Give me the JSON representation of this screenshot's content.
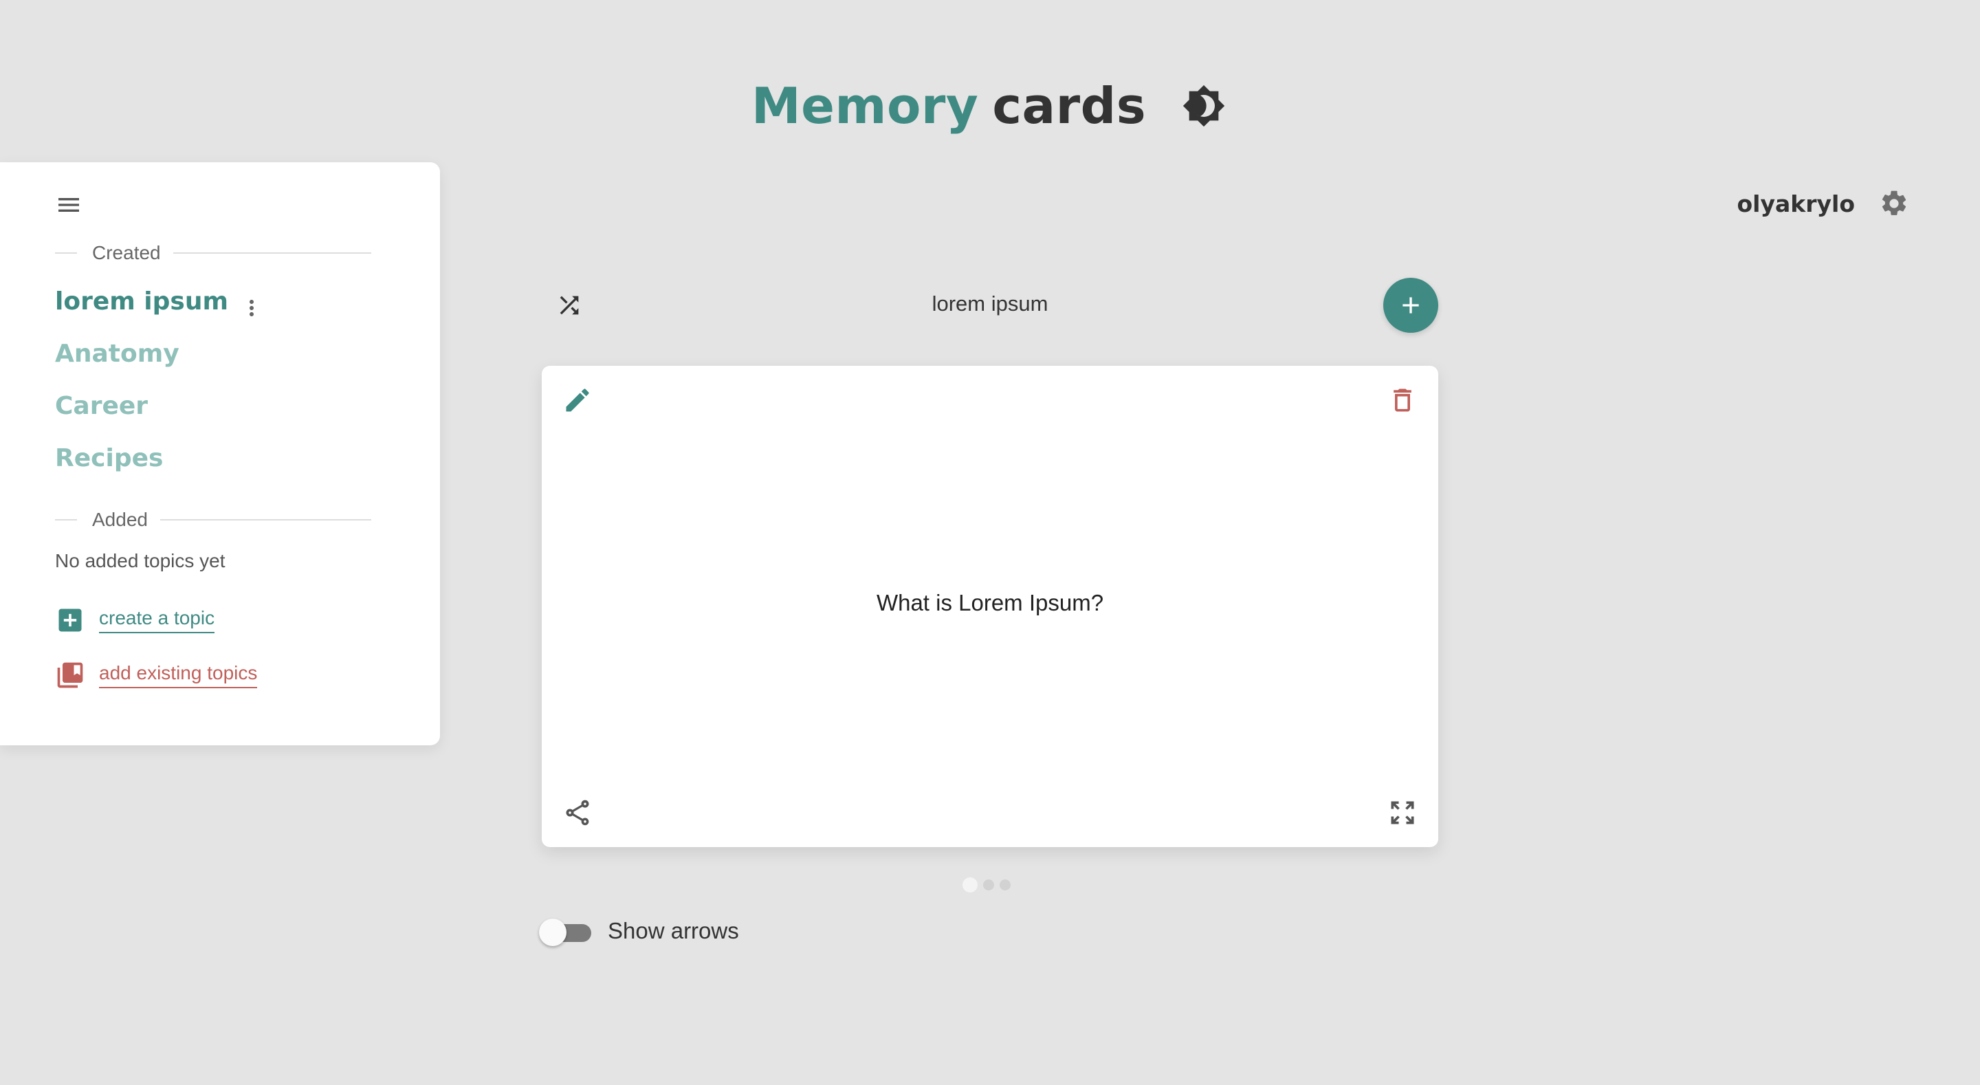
{
  "header": {
    "title_part1": "Memory",
    "title_part2": "cards",
    "theme_icon": "brightness-contrast-icon"
  },
  "user": {
    "username": "olyakrylo",
    "settings_icon": "gear-icon"
  },
  "sidebar": {
    "menu_icon": "hamburger-menu-icon",
    "created_label": "Created",
    "created_topics": [
      {
        "label": "lorem ipsum",
        "active": true
      },
      {
        "label": "Anatomy",
        "active": false
      },
      {
        "label": "Career",
        "active": false
      },
      {
        "label": "Recipes",
        "active": false
      }
    ],
    "added_label": "Added",
    "added_empty": "No added topics yet",
    "create_topic_label": "create a topic",
    "add_existing_label": "add existing topics"
  },
  "card_area": {
    "topic_title": "lorem ipsum",
    "shuffle_icon": "shuffle-icon",
    "add_icon": "plus-icon",
    "card": {
      "question": "What is Lorem Ipsum?",
      "edit_icon": "pencil-icon",
      "delete_icon": "trash-icon",
      "share_icon": "share-icon",
      "fullscreen_icon": "fullscreen-icon"
    },
    "pagination": {
      "total": 3,
      "current": 1
    },
    "show_arrows_label": "Show arrows",
    "show_arrows_enabled": false
  },
  "colors": {
    "accent": "#3f8a83",
    "accent_light": "#8fc0ba",
    "danger": "#c0605a",
    "background": "#e4e4e4"
  }
}
